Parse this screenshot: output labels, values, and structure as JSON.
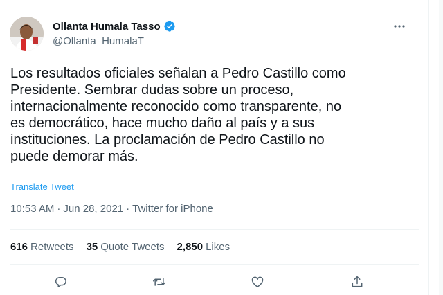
{
  "author": {
    "display_name": "Ollanta Humala Tasso",
    "handle": "@Ollanta_HumalaT",
    "verified": true
  },
  "tweet": {
    "text": "Los resultados oficiales señalan a Pedro Castillo como\nPresidente. Sembrar dudas sobre un proceso,\ninternacionalmente reconocido como transparente, no\nes democrático, hace mucho daño al país y a sus\ninstituciones. La proclamación de Pedro Castillo no\npuede demorar más.",
    "translate_label": "Translate Tweet",
    "time": "10:53 AM",
    "separator": "·",
    "date": "Jun 28, 2021",
    "source": "Twitter for iPhone"
  },
  "stats": {
    "retweets_count": "616",
    "retweets_label": "Retweets",
    "quotes_count": "35",
    "quotes_label": "Quote Tweets",
    "likes_count": "2,850",
    "likes_label": "Likes"
  },
  "icons": {
    "more": "more-options-icon",
    "reply": "reply-icon",
    "retweet": "retweet-icon",
    "like": "like-icon",
    "share": "share-icon",
    "verified": "verified-badge-icon"
  },
  "colors": {
    "accent": "#1d9bf0",
    "text": "#0f1419",
    "secondary": "#536471",
    "divider": "#eff3f4"
  }
}
